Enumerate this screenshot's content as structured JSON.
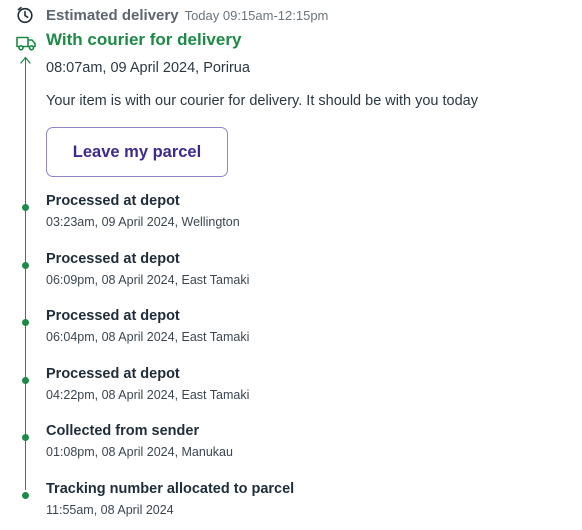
{
  "eta": {
    "label": "Estimated delivery",
    "time": "Today 09:15am-12:15pm"
  },
  "current": {
    "status": "With courier for delivery",
    "datetime": "08:07am, 09 April 2024, Porirua",
    "message": "Your item is with our courier for delivery. It should be with you today",
    "action_label": "Leave my parcel"
  },
  "events": [
    {
      "title": "Processed at depot",
      "detail": "03:23am, 09 April 2024, Wellington"
    },
    {
      "title": "Processed at depot",
      "detail": "06:09pm, 08 April 2024, East Tamaki"
    },
    {
      "title": "Processed at depot",
      "detail": "06:04pm, 08 April 2024, East Tamaki"
    },
    {
      "title": "Processed at depot",
      "detail": "04:22pm, 08 April 2024, East Tamaki"
    },
    {
      "title": "Collected from sender",
      "detail": "01:08pm, 08 April 2024, Manukau"
    },
    {
      "title": "Tracking number allocated to parcel",
      "detail": "11:55am, 08 April 2024"
    }
  ],
  "colors": {
    "accent_green": "#1d8a45",
    "button_text": "#3d2a8f",
    "button_border": "#8c86c8"
  },
  "icons": {
    "eta": "clock-icon",
    "current": "delivery-truck-icon",
    "timeline_head": "arrow-up-icon"
  }
}
